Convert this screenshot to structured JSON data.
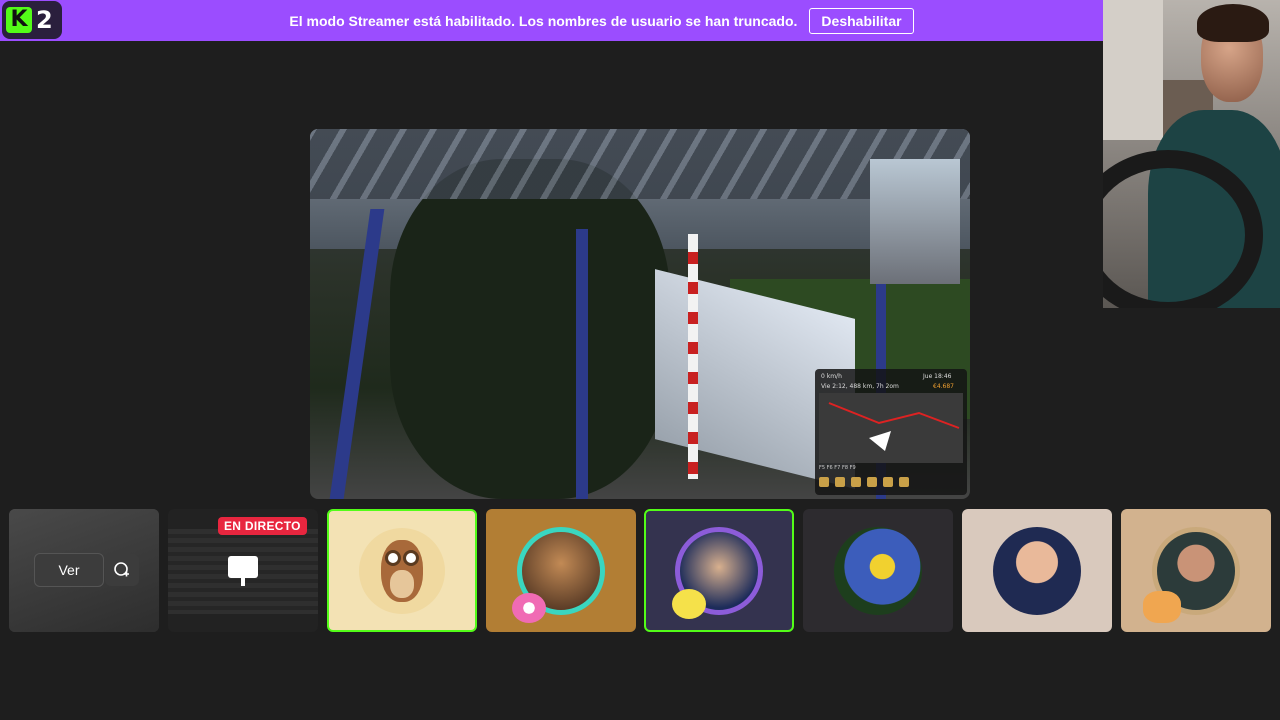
{
  "banner": {
    "logo_letter": "K",
    "logo_number": "2",
    "message": "El modo Streamer está habilitado. Los nombres de usuario se han truncado.",
    "disable_label": "Deshabilitar",
    "background_color": "#9b4dff"
  },
  "thumbnails": {
    "view_label": "Ver",
    "pip_icon": "picture-in-picture-icon",
    "live_badge": "EN DIRECTO",
    "screen_icon": "monitor-icon",
    "active_color": "#53fc18"
  },
  "hud": {
    "speed": "0 km/h",
    "time": "Jue 18:46",
    "money": "€4.687",
    "distance": "Vie 2:12, 488 km, 7h 2om",
    "keys": "F5   F6   F7   F8   F9"
  }
}
